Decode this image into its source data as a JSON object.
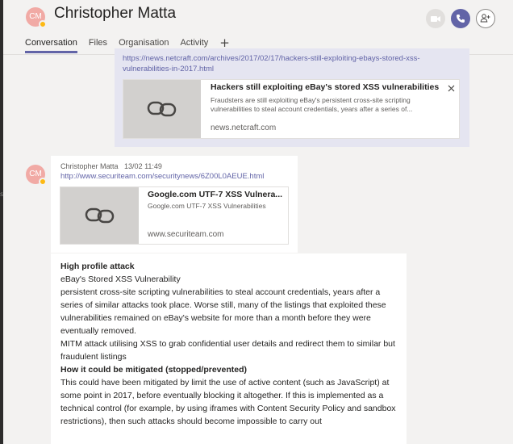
{
  "header": {
    "avatar_initials": "CM",
    "title": "Christopher Matta",
    "tabs": [
      "Conversation",
      "Files",
      "Organisation",
      "Activity"
    ],
    "add_tab_symbol": "+"
  },
  "left_rail_mark": "s",
  "message1": {
    "link": "https://news.netcraft.com/archives/2017/02/17/hackers-still-exploiting-ebays-stored-xss-vulnerabilities-in-2017.html",
    "card": {
      "title": "Hackers still exploiting eBay's stored XSS vulnerabilities i...",
      "description": "Fraudsters are still exploiting eBay's persistent cross-site scripting vulnerabilities to steal account credentials, years after a series of...",
      "domain": "news.netcraft.com"
    }
  },
  "message2": {
    "avatar_initials": "CM",
    "author": "Christopher Matta",
    "timestamp": "13/02 11:49",
    "link": "http://www.securiteam.com/securitynews/6Z00L0AEUE.html",
    "card": {
      "title": "Google.com UTF-7 XSS Vulnera...",
      "description": "Google.com UTF-7 XSS Vulnerabilities",
      "domain": "www.securiteam.com"
    }
  },
  "message3": {
    "heading1": "High profile attack",
    "line1": "eBay's Stored XSS Vulnerability",
    "para1": "persistent cross-site scripting vulnerabilities to steal account credentials, years after a series of similar attacks took place. Worse still, many of the listings that exploited these vulnerabilities remained on eBay's website for more than a month before they were eventually removed.",
    "para2": "MITM attack utilising XSS to grab confidential user details and redirect them to similar but fraudulent listings",
    "heading2": "How it could be mitigated (stopped/prevented)",
    "para3": "This could have been mitigated by limit the use of active content (such as JavaScript) at some point in 2017, before eventually blocking it altogether. If this is implemented as a technical control (for example, by using iframes with Content Security Policy and sandbox restrictions), then such attacks should become impossible to carry out"
  },
  "colors": {
    "accent": "#6264a7",
    "avatar": "#f1aaa5",
    "presence": "#fdb913"
  }
}
